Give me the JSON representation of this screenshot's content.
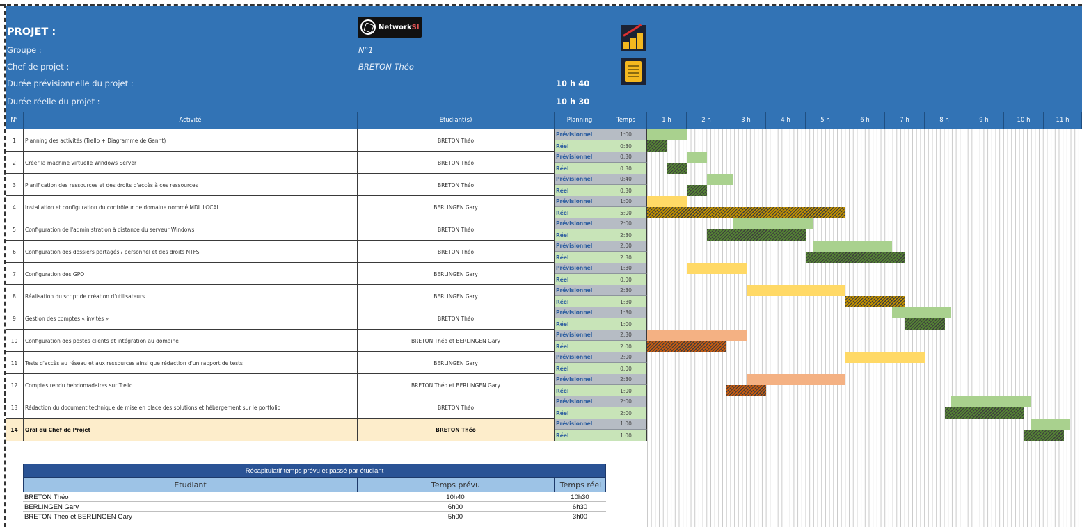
{
  "header": {
    "project_label": "PROJET :",
    "group_label": "Groupe :",
    "group_value": "N°1",
    "chef_label": "Chef de projet :",
    "chef_value": "BRETON Théo",
    "duree_prev_label": "Durée prévisionnelle du projet :",
    "duree_prev_value": "10 h 40",
    "duree_reel_label": "Durée réelle du projet :",
    "duree_reel_value": "10 h 30",
    "logo_text": "NetworkSI"
  },
  "table": {
    "headers": [
      "N°",
      "Activité",
      "Etudiant(s)",
      "Planning",
      "Temps"
    ],
    "hours": [
      "1 h",
      "2 h",
      "3 h",
      "4 h",
      "5 h",
      "6 h",
      "7 h",
      "8 h",
      "9 h",
      "10 h",
      "11 h"
    ],
    "planning_prev": "Prévisionnel",
    "planning_reel": "Réel",
    "rows": [
      {
        "num": "1",
        "activity": "Planning des activités (Trello + Diagramme de Gannt)",
        "student": "BRETON Théo",
        "prev_time": "1:00",
        "reel_time": "0:30",
        "prev_start": 0,
        "prev_end": 60,
        "reel_start": 0,
        "reel_end": 30,
        "color": "green"
      },
      {
        "num": "2",
        "activity": "Créer la machine virtuelle Windows Server",
        "student": "BRETON Théo",
        "prev_time": "0:30",
        "reel_time": "0:30",
        "prev_start": 60,
        "prev_end": 90,
        "reel_start": 30,
        "reel_end": 60,
        "color": "green"
      },
      {
        "num": "3",
        "activity": "Planification des ressources et des droits d'accès à ces ressources",
        "student": "BRETON Théo",
        "prev_time": "0:40",
        "reel_time": "0:30",
        "prev_start": 90,
        "prev_end": 130,
        "reel_start": 60,
        "reel_end": 90,
        "color": "green"
      },
      {
        "num": "4",
        "activity": "Installation et configuration du contrôleur de domaine nommé MDL.LOCAL",
        "student": "BERLINGEN Gary",
        "prev_time": "1:00",
        "reel_time": "5:00",
        "prev_start": 0,
        "prev_end": 60,
        "reel_start": 0,
        "reel_end": 300,
        "color": "yellow"
      },
      {
        "num": "5",
        "activity": "Configuration de l'administration à distance du serveur Windows",
        "student": "BRETON Théo",
        "prev_time": "2:00",
        "reel_time": "2:30",
        "prev_start": 130,
        "prev_end": 250,
        "reel_start": 90,
        "reel_end": 240,
        "color": "green"
      },
      {
        "num": "6",
        "activity": "Configuration des dossiers partagés / personnel et des droits NTFS",
        "student": "BRETON Théo",
        "prev_time": "2:00",
        "reel_time": "2:30",
        "prev_start": 250,
        "prev_end": 370,
        "reel_start": 240,
        "reel_end": 390,
        "color": "green"
      },
      {
        "num": "7",
        "activity": "Configuration des GPO",
        "student": "BERLINGEN Gary",
        "prev_time": "1:30",
        "reel_time": "0:00",
        "prev_start": 60,
        "prev_end": 150,
        "reel_start": 0,
        "reel_end": 0,
        "color": "yellow"
      },
      {
        "num": "8",
        "activity": "Réalisation du script de création d'utilisateurs",
        "student": "BERLINGEN Gary",
        "prev_time": "2:30",
        "reel_time": "1:30",
        "prev_start": 150,
        "prev_end": 300,
        "reel_start": 300,
        "reel_end": 390,
        "color": "yellow"
      },
      {
        "num": "9",
        "activity": "Gestion des comptes « invités »",
        "student": "BRETON Théo",
        "prev_time": "1:30",
        "reel_time": "1:00",
        "prev_start": 370,
        "prev_end": 460,
        "reel_start": 390,
        "reel_end": 450,
        "color": "green"
      },
      {
        "num": "10",
        "activity": "Configuration des postes clients et intégration au domaine",
        "student": "BRETON Théo et BERLINGEN Gary",
        "prev_time": "2:30",
        "reel_time": "2:00",
        "prev_start": 0,
        "prev_end": 150,
        "reel_start": 0,
        "reel_end": 120,
        "color": "orange"
      },
      {
        "num": "11",
        "activity": "Tests d'accès au réseau et aux ressources ainsi que rédaction d'un rapport de tests",
        "student": "BERLINGEN Gary",
        "prev_time": "2:00",
        "reel_time": "0:00",
        "prev_start": 300,
        "prev_end": 420,
        "reel_start": 0,
        "reel_end": 0,
        "color": "yellow"
      },
      {
        "num": "12",
        "activity": "Comptes rendu hebdomadaires sur Trello",
        "student": "BRETON Théo et BERLINGEN Gary",
        "prev_time": "2:30",
        "reel_time": "1:00",
        "prev_start": 150,
        "prev_end": 300,
        "reel_start": 120,
        "reel_end": 180,
        "color": "orange"
      },
      {
        "num": "13",
        "activity": "Rédaction du document technique de mise en place des solutions et hébergement sur le portfolio",
        "student": "BRETON Théo",
        "prev_time": "2:00",
        "reel_time": "2:00",
        "prev_start": 460,
        "prev_end": 580,
        "reel_start": 450,
        "reel_end": 570,
        "color": "green"
      },
      {
        "num": "14",
        "activity": "Oral du Chef de Projet",
        "student": "BRETON Théo",
        "prev_time": "1:00",
        "reel_time": "1:00",
        "prev_start": 580,
        "prev_end": 640,
        "reel_start": 570,
        "reel_end": 630,
        "color": "green",
        "highlight": true
      }
    ]
  },
  "colors": {
    "green_prev": "#a9d18e",
    "green_reel": "#548235",
    "yellow_prev": "#ffd966",
    "yellow_reel": "#bf8f00",
    "orange_prev": "#f4b183",
    "orange_reel": "#c55a11",
    "header_blue": "#3273b5"
  },
  "summary": {
    "title": "Récapitulatif temps prévu et passé par étudiant",
    "headers": [
      "Etudiant",
      "Temps prévu",
      "Temps réel"
    ],
    "rows": [
      {
        "student": "BRETON Théo",
        "prevu": "10h40",
        "reel": "10h30"
      },
      {
        "student": "BERLINGEN Gary",
        "prevu": "6h00",
        "reel": "6h30"
      },
      {
        "student": "BRETON Théo et BERLINGEN Gary",
        "prevu": "5h00",
        "reel": "3h00"
      }
    ]
  }
}
